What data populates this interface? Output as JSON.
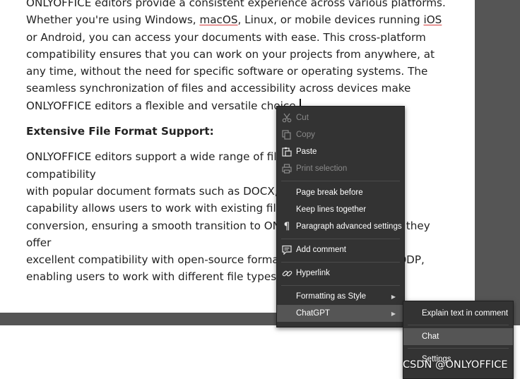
{
  "document": {
    "paragraph1": [
      {
        "text": "ONLYOFFICE editors provide a consistent experience across various platforms. Whether you're using Windows, "
      },
      {
        "text": "macOS",
        "spell": true
      },
      {
        "text": ", Linux, or mobile devices running "
      },
      {
        "text": "iOS",
        "spell": true
      },
      {
        "text": " or Android, you can access your documents with ease. This cross-platform compatibility ensures that you can work on your projects from anywhere, at any time, without the need for specific software or operating systems. The seamless synchronization of files and accessibility across devices make ONLYOFFICE editors a flexible and versatile choice."
      }
    ],
    "heading": "Extensive File Format Support:",
    "paragraph2_lines": [
      "ONLYOFFICE editors support a wide range of file formats, ensuring compatibility",
      "with popular document formats such as DOCX, XLSX, and PPTX. This",
      "capability allows users to work with existing files without the need for",
      "conversion, ensuring a smooth transition to ONLYOFFICE. Additionally, they offer",
      "excellent compatibility with open-source formats like ODT, ODS, and ODP,",
      "enabling users to work with different file types effortlessly."
    ]
  },
  "context_menu": {
    "items": [
      {
        "label": "Cut",
        "icon": "scissors-icon",
        "disabled": true
      },
      {
        "label": "Copy",
        "icon": "copy-icon",
        "disabled": true
      },
      {
        "label": "Paste",
        "icon": "paste-icon",
        "disabled": false
      },
      {
        "label": "Print selection",
        "icon": "print-icon",
        "disabled": true
      },
      {
        "label": "Page break before",
        "icon": "",
        "disabled": false
      },
      {
        "label": "Keep lines together",
        "icon": "",
        "disabled": false
      },
      {
        "label": "Paragraph advanced settings",
        "icon": "pilcrow-icon",
        "disabled": false
      },
      {
        "label": "Add comment",
        "icon": "comment-icon",
        "disabled": false
      },
      {
        "label": "Hyperlink",
        "icon": "link-icon",
        "disabled": false
      },
      {
        "label": "Formatting as Style",
        "icon": "",
        "disabled": false,
        "submenu": true
      },
      {
        "label": "ChatGPT",
        "icon": "",
        "disabled": false,
        "submenu": true,
        "highlighted": true
      }
    ]
  },
  "submenu": {
    "items": [
      {
        "label": "Explain text in comment"
      },
      {
        "label": "Chat",
        "highlighted": true
      },
      {
        "label": "Settings"
      }
    ]
  },
  "watermark": "CSDN @ONLYOFFICE",
  "colors": {
    "menu_bg": "#333333",
    "menu_highlight": "#555555",
    "disabled_text": "#8a8a8a",
    "gutter": "#555555",
    "spellcheck_underline": "#d23a3a"
  }
}
